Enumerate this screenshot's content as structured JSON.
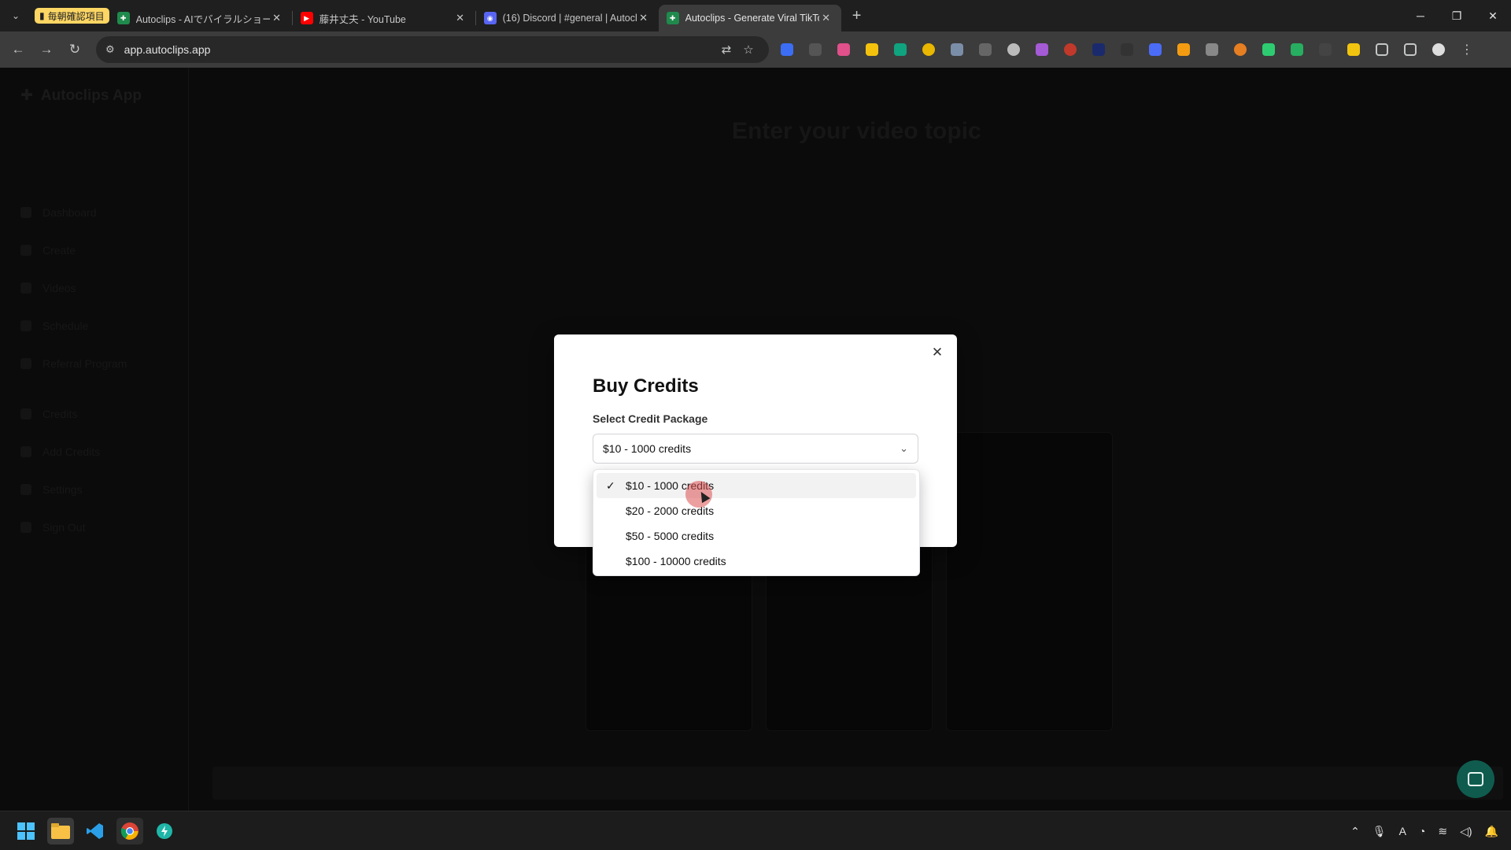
{
  "browser": {
    "tab_group_label": "毎朝確認項目",
    "tabs": [
      {
        "title": "Autoclips - AIでバイラルショート動",
        "favicon_color": "#1f8a4c"
      },
      {
        "title": "藤井丈夫 - YouTube",
        "favicon_color": "#ff0000"
      },
      {
        "title": "(16) Discord | #general | Autocl",
        "favicon_color": "#5865f2"
      },
      {
        "title": "Autoclips - Generate Viral TikTo",
        "favicon_color": "#1f8a4c",
        "active": true
      }
    ],
    "url": "app.autoclips.app"
  },
  "app": {
    "brand": "Autoclips App",
    "heading": "Enter your video topic",
    "sidebar_items": [
      "Dashboard",
      "Create",
      "Videos",
      "Schedule",
      "Referral Program",
      "Credits",
      "Add Credits",
      "Settings",
      "Sign Out"
    ]
  },
  "modal": {
    "title": "Buy Credits",
    "field_label": "Select Credit Package",
    "selected": "$10 - 1000 credits",
    "options": [
      "$10 - 1000 credits",
      "$20 - 2000 credits",
      "$50 - 5000 credits",
      "$100 - 10000 credits"
    ]
  },
  "icons": {
    "modal_close": "close-icon",
    "select_chevron": "chevron-down-icon",
    "selected_check": "check-icon",
    "chat": "chat-icon"
  },
  "colors": {
    "overlay": "#0b0b0b",
    "modal_bg": "#ffffff",
    "highlight": "#f2f2f3",
    "chat_bubble": "#0f5c4f"
  }
}
